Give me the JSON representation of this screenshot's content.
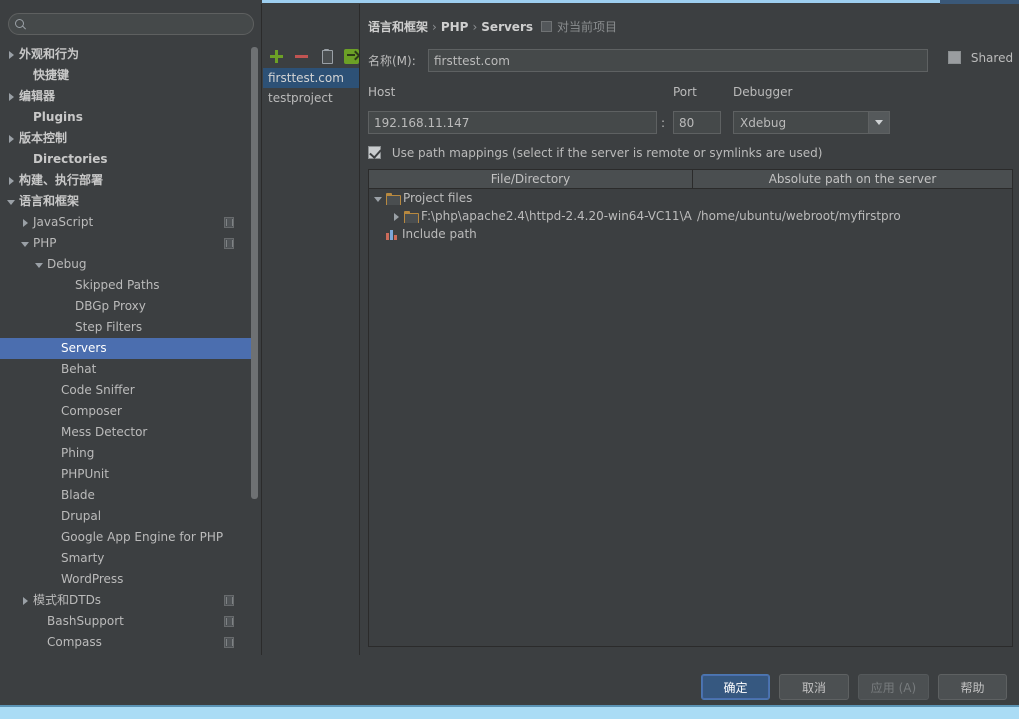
{
  "search": {
    "placeholder": "",
    "value": "",
    "icon": "search-icon"
  },
  "sidebar": {
    "items": [
      {
        "label": "外观和行为",
        "arrow": "closed",
        "indent": 0,
        "bold": true,
        "scope": false
      },
      {
        "label": "快捷键",
        "arrow": "none",
        "indent": 1,
        "bold": true,
        "scope": false
      },
      {
        "label": "编辑器",
        "arrow": "closed",
        "indent": 0,
        "bold": true,
        "scope": false
      },
      {
        "label": "Plugins",
        "arrow": "none",
        "indent": 1,
        "bold": true,
        "scope": false
      },
      {
        "label": "版本控制",
        "arrow": "closed",
        "indent": 0,
        "bold": true,
        "scope": false
      },
      {
        "label": "Directories",
        "arrow": "none",
        "indent": 1,
        "bold": true,
        "scope": false
      },
      {
        "label": "构建、执行部署",
        "arrow": "closed",
        "indent": 0,
        "bold": true,
        "scope": false
      },
      {
        "label": "语言和框架",
        "arrow": "open",
        "indent": 0,
        "bold": true,
        "scope": false
      },
      {
        "label": "JavaScript",
        "arrow": "closed",
        "indent": 1,
        "bold": false,
        "scope": true
      },
      {
        "label": "PHP",
        "arrow": "open",
        "indent": 1,
        "bold": false,
        "scope": true
      },
      {
        "label": "Debug",
        "arrow": "open",
        "indent": 2,
        "bold": false,
        "scope": false
      },
      {
        "label": "Skipped Paths",
        "arrow": "none",
        "indent": 4,
        "bold": false,
        "scope": false
      },
      {
        "label": "DBGp Proxy",
        "arrow": "none",
        "indent": 4,
        "bold": false,
        "scope": false
      },
      {
        "label": "Step Filters",
        "arrow": "none",
        "indent": 4,
        "bold": false,
        "scope": false
      },
      {
        "label": "Servers",
        "arrow": "none",
        "indent": 3,
        "bold": false,
        "scope": false,
        "selected": true
      },
      {
        "label": "Behat",
        "arrow": "none",
        "indent": 3,
        "bold": false,
        "scope": false
      },
      {
        "label": "Code Sniffer",
        "arrow": "none",
        "indent": 3,
        "bold": false,
        "scope": false
      },
      {
        "label": "Composer",
        "arrow": "none",
        "indent": 3,
        "bold": false,
        "scope": false
      },
      {
        "label": "Mess Detector",
        "arrow": "none",
        "indent": 3,
        "bold": false,
        "scope": false
      },
      {
        "label": "Phing",
        "arrow": "none",
        "indent": 3,
        "bold": false,
        "scope": false
      },
      {
        "label": "PHPUnit",
        "arrow": "none",
        "indent": 3,
        "bold": false,
        "scope": false
      },
      {
        "label": "Blade",
        "arrow": "none",
        "indent": 3,
        "bold": false,
        "scope": false
      },
      {
        "label": "Drupal",
        "arrow": "none",
        "indent": 3,
        "bold": false,
        "scope": false
      },
      {
        "label": "Google App Engine for PHP",
        "arrow": "none",
        "indent": 3,
        "bold": false,
        "scope": false
      },
      {
        "label": "Smarty",
        "arrow": "none",
        "indent": 3,
        "bold": false,
        "scope": false
      },
      {
        "label": "WordPress",
        "arrow": "none",
        "indent": 3,
        "bold": false,
        "scope": false
      },
      {
        "label": "模式和DTDs",
        "arrow": "closed",
        "indent": 1,
        "bold": false,
        "scope": true
      },
      {
        "label": "BashSupport",
        "arrow": "none",
        "indent": 2,
        "bold": false,
        "scope": true
      },
      {
        "label": "Compass",
        "arrow": "none",
        "indent": 2,
        "bold": false,
        "scope": true
      }
    ]
  },
  "server_toolbar": {
    "add": "add-server",
    "remove": "remove-server",
    "copy": "copy-server",
    "import": "import-server"
  },
  "server_list": {
    "items": [
      {
        "label": "firsttest.com",
        "selected": true
      },
      {
        "label": "testproject",
        "selected": false
      }
    ]
  },
  "breadcrumb": {
    "part1": "语言和框架",
    "sep": "›",
    "part2": "PHP",
    "part3": "Servers",
    "scope_note": "对当前项目"
  },
  "form": {
    "name_label": "名称(M):",
    "name_value": "firsttest.com",
    "shared_label": "Shared",
    "shared_checked": false,
    "host_label": "Host",
    "host_value": "192.168.11.147",
    "colon": ":",
    "port_label": "Port",
    "port_value": "80",
    "debugger_label": "Debugger",
    "debugger_value": "Xdebug",
    "mappings_checkbox_label": "Use path mappings (select if the server is remote or symlinks are used)",
    "mappings_checked": true
  },
  "mapping_table": {
    "columns": [
      "File/Directory",
      "Absolute path on the server"
    ],
    "rows": [
      {
        "arrow": "open",
        "icon": "folder-icon",
        "indent": 0,
        "file": "Project files",
        "server": ""
      },
      {
        "arrow": "closed",
        "icon": "folder-icon",
        "indent": 1,
        "file": "F:\\php\\apache2.4\\httpd-2.4.20-win64-VC11\\A",
        "server": "/home/ubuntu/webroot/myfirstpro"
      },
      {
        "arrow": "none",
        "icon": "bars-icon",
        "indent": 0,
        "file": "Include path",
        "server": ""
      }
    ]
  },
  "buttons": {
    "ok": "确定",
    "cancel": "取消",
    "apply": "应用 (A)",
    "help": "帮助"
  },
  "colors": {
    "background": "#3c3f41",
    "selection_blue": "#4b6eaf",
    "list_selection": "#2d5176",
    "accent_green": "#6ca026",
    "accent_red": "#c15452",
    "bottom_bar": "#aadcf5"
  }
}
